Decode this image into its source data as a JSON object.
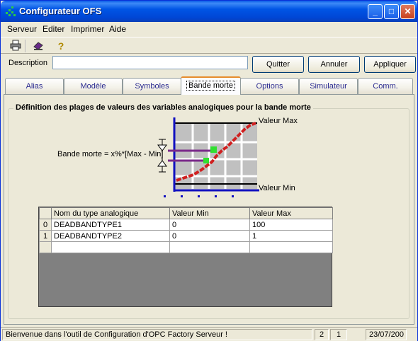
{
  "window": {
    "title": "Configurateur OFS"
  },
  "menu": [
    {
      "label": "Serveur"
    },
    {
      "label": "Editer"
    },
    {
      "label": "Imprimer"
    },
    {
      "label": "Aide"
    }
  ],
  "toolbar": {
    "icons": [
      "printer-icon",
      "eraser-icon",
      "help-icon"
    ]
  },
  "description": {
    "label": "Description",
    "value": ""
  },
  "buttons": {
    "quit": "Quitter",
    "cancel": "Annuler",
    "apply": "Appliquer"
  },
  "tabs": [
    {
      "label": "Alias"
    },
    {
      "label": "Modèle"
    },
    {
      "label": "Symboles"
    },
    {
      "label": "Bande morte",
      "active": true
    },
    {
      "label": "Options"
    },
    {
      "label": "Simulateur"
    },
    {
      "label": "Comm."
    }
  ],
  "group": {
    "title": "Définition des plages de valeurs des variables analogiques pour la bande morte",
    "deadband_formula": "Bande morte = x%*[Max - Min]",
    "value_max_label": "Valeur Max",
    "value_min_label": "Valeur Min"
  },
  "table": {
    "columns": [
      "Nom du type analogique",
      "Valeur Min",
      "Valeur Max"
    ],
    "rows": [
      {
        "index": "0",
        "name": "DEADBANDTYPE1",
        "min": "0",
        "max": "100"
      },
      {
        "index": "1",
        "name": "DEADBANDTYPE2",
        "min": "0",
        "max": "1"
      }
    ]
  },
  "statusbar": {
    "message": "Bienvenue dans l'outil de Configuration d'OPC Factory Serveur !",
    "pane1": "2",
    "pane2": "1",
    "date": "23/07/200"
  }
}
